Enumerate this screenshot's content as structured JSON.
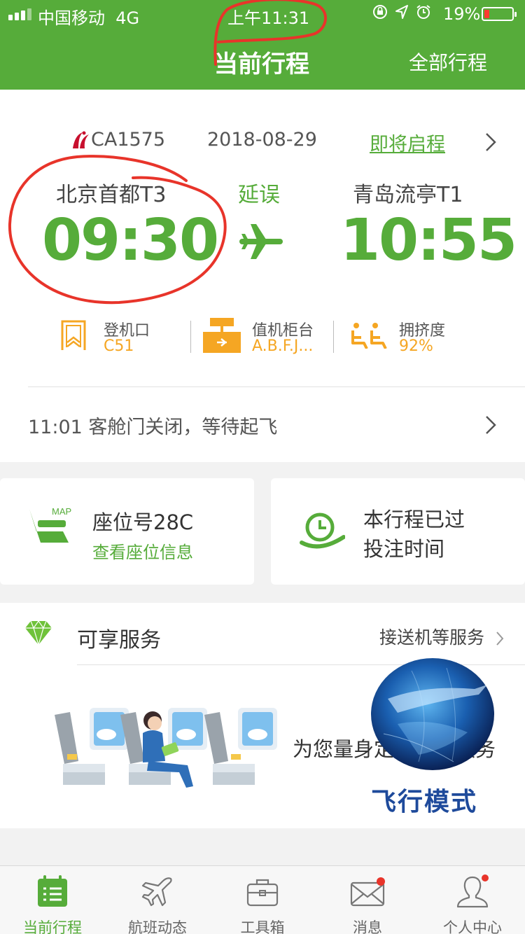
{
  "status_bar": {
    "carrier": "中国移动",
    "network": "4G",
    "time": "上午11:31",
    "battery_pct": "19%",
    "battery_level": 0.19
  },
  "nav": {
    "title": "当前行程",
    "right_action": "全部行程"
  },
  "flight": {
    "flight_no": "CA1575",
    "date": "2018-08-29",
    "status": "即将启程",
    "departure_city": "北京首都T3",
    "departure_time": "09:30",
    "arrival_city": "青岛流亭T1",
    "arrival_time": "10:55",
    "delay_label": "延误"
  },
  "info": {
    "gate_label": "登机口",
    "gate_value": "C51",
    "counter_label": "值机柜台",
    "counter_value": "A.B.F.J...",
    "crowd_label": "拥挤度",
    "crowd_value": "92%"
  },
  "progress": {
    "text": "11:01  客舱门关闭，等待起飞"
  },
  "seat": {
    "title": "座位号28C",
    "link": "查看座位信息",
    "icon_text": "MAP"
  },
  "deadline": {
    "line1": "本行程已过",
    "line2": "投注时间"
  },
  "services": {
    "title": "可享服务",
    "link": "接送机等服务",
    "description": "为您量身定制专属服务",
    "overlay_label": "飞行模式"
  },
  "tabs": [
    {
      "label": "当前行程",
      "icon": "calendar-icon",
      "active": true
    },
    {
      "label": "航班动态",
      "icon": "airplane-icon",
      "active": false
    },
    {
      "label": "工具箱",
      "icon": "toolbox-icon",
      "active": false
    },
    {
      "label": "消息",
      "icon": "mail-icon",
      "active": false
    },
    {
      "label": "个人中心",
      "icon": "user-icon",
      "active": false
    }
  ],
  "colors": {
    "brand_green": "#56ac3a",
    "accent_orange": "#f5a623",
    "annotation_red": "#e8342a",
    "overlay_blue": "#1e4a9b"
  }
}
